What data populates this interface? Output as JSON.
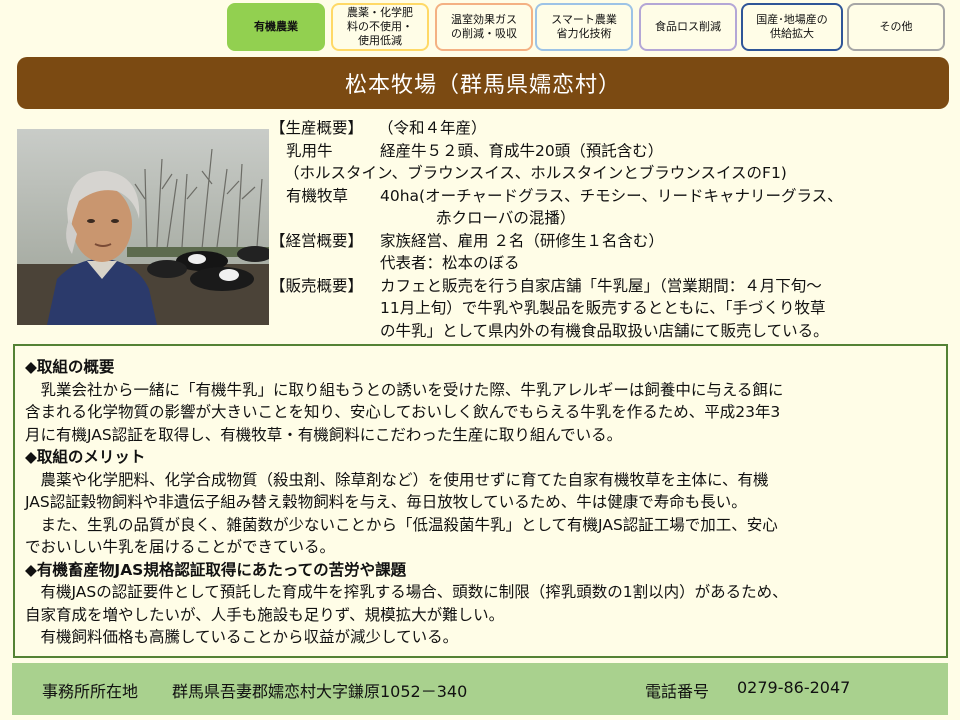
{
  "tabs": [
    {
      "label": "有機農業",
      "active": true,
      "color": "#92d050"
    },
    {
      "label": "農薬・化学肥\n料の不使用・\n使用低減",
      "active": false,
      "color": "#ffd966"
    },
    {
      "label": "温室効果ガス\nの削減・吸収",
      "active": false,
      "color": "#f4b183"
    },
    {
      "label": "スマート農業\n省力化技術",
      "active": false,
      "color": "#9dc3e6"
    },
    {
      "label": "食品ロス削減",
      "active": false,
      "color": "#b4a7d6"
    },
    {
      "label": "国産･地場産の\n供給拡大",
      "active": false,
      "color": "#2f5597"
    },
    {
      "label": "その他",
      "active": false,
      "color": "#a6a6a6"
    }
  ],
  "title": "松本牧場（群馬県嬬恋村）",
  "profile": {
    "production_label": "【生産概要】",
    "production_year": "（令和４年産）",
    "dairy_label": "乳用牛",
    "dairy_value": "経産牛５２頭、育成牛20頭（預託含む）",
    "dairy_breeds": "（ホルスタイン、ブラウンスイス、ホルスタインとブラウンスイスのF1)",
    "pasture_label": "有機牧草",
    "pasture_value": "40ha(オーチャードグラス、チモシー、リードキャナリーグラス、",
    "pasture_value2": "赤クローバの混播）",
    "management_label": "【経営概要】",
    "management_value": "家族経営、雇用 ２名（研修生１名含む）",
    "representative": "代表者：松本のぼる",
    "sales_label": "【販売概要】",
    "sales_line1": "カフェと販売を行う自家店舗「牛乳屋」（営業期間：４月下旬～",
    "sales_line2": "11月上旬）で牛乳や乳製品を販売するとともに、「手づくり牧草",
    "sales_line3": "の牛乳」として県内外の有機食品取扱い店舗にて販売している。"
  },
  "sections": {
    "overview_heading": "◆取組の概要",
    "overview_lines": [
      "　乳業会社から一緒に「有機牛乳」に取り組もうとの誘いを受けた際、牛乳アレルギーは飼養中に与える餌に",
      "含まれる化学物質の影響が大きいことを知り、安心しておいしく飲んでもらえる牛乳を作るため、平成23年3",
      "月に有機JAS認証を取得し、有機牧草・有機飼料にこだわった生産に取り組んでいる。"
    ],
    "merit_heading": "◆取組のメリット",
    "merit_lines": [
      "　農薬や化学肥料、化学合成物質（殺虫剤、除草剤など）を使用せずに育てた自家有機牧草を主体に、有機",
      "JAS認証穀物飼料や非遺伝子組み替え穀物飼料を与え、毎日放牧しているため、牛は健康で寿命も長い。",
      "　また、生乳の品質が良く、雑菌数が少ないことから「低温殺菌牛乳」として有機JAS認証工場で加工、安心",
      "でおいしい牛乳を届けることができている。"
    ],
    "challenge_heading": "◆有機畜産物JAS規格認証取得にあたっての苦労や課題",
    "challenge_lines": [
      "　有機JASの認証要件として預託した育成牛を搾乳する場合、頭数に制限（搾乳頭数の1割以内）があるため、",
      "自家育成を増やしたいが、人手も施設も足りず、規模拡大が難しい。",
      "　有機飼料価格も高騰していることから収益が減少している。"
    ]
  },
  "footer": {
    "address_label": "事務所所在地",
    "address": "群馬県吾妻郡嬬恋村大字鎌原1052－340",
    "phone_label": "電話番号",
    "phone": "0279-86-2047"
  }
}
